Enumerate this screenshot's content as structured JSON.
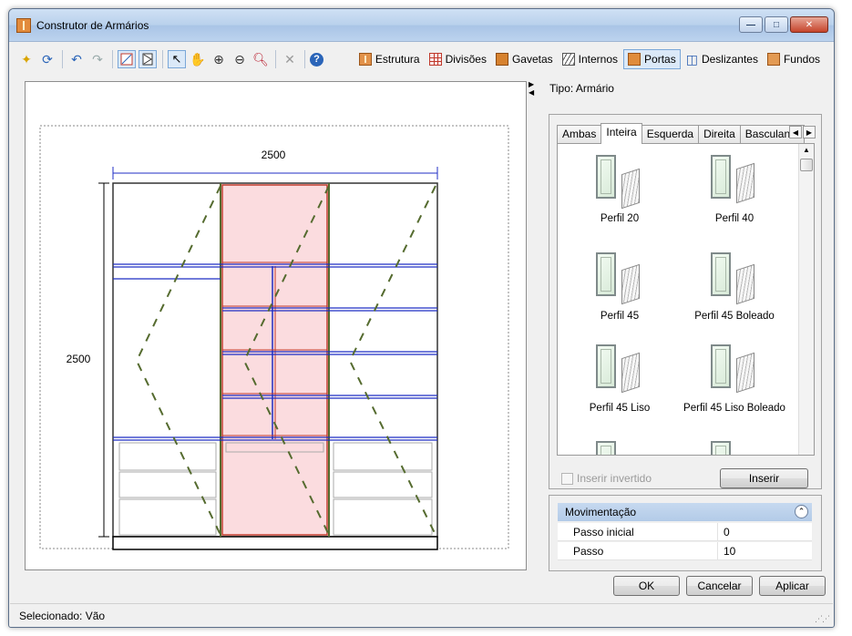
{
  "window": {
    "title": "Construtor de Armários",
    "controls": {
      "minimize": "—",
      "maximize": "□",
      "close": "✕"
    }
  },
  "toolbar": {
    "left_icons": [
      "new-icon",
      "refresh-icon",
      "undo-icon",
      "redo-icon",
      "door-mode-icon",
      "panel-mode-icon",
      "select-icon",
      "hand-add-icon",
      "zoom-extent-icon",
      "zoom-out-icon",
      "zoom-in-icon",
      "delete-icon",
      "help-icon"
    ],
    "buttons": {
      "estrutura": "Estrutura",
      "divisoes": "Divisões",
      "gavetas": "Gavetas",
      "internos": "Internos",
      "portas": "Portas",
      "deslizantes": "Deslizantes",
      "fundos": "Fundos"
    }
  },
  "drawing": {
    "width_label": "2500",
    "height_label": "2500",
    "colors": {
      "selected_fill": "#fbdcdf",
      "selected_stroke": "#c0392b",
      "shelf": "#1f2ec4",
      "door_diag": "#556b2f",
      "frame": "#000000"
    }
  },
  "right": {
    "tipo": "Tipo: Armário",
    "tabs": [
      "Ambas",
      "Inteira",
      "Esquerda",
      "Direita",
      "Basculante"
    ],
    "active_tab": "Inteira",
    "gallery": [
      {
        "name": "Perfil 20"
      },
      {
        "name": "Perfil 40"
      },
      {
        "name": "Perfil 45"
      },
      {
        "name": "Perfil 45 Boleado"
      },
      {
        "name": "Perfil 45 Liso"
      },
      {
        "name": "Perfil 45 Liso Boleado"
      }
    ],
    "inverted_label": "Inserir invertido",
    "insert_button": "Inserir"
  },
  "movement": {
    "title": "Movimentação",
    "rows": [
      {
        "key": "Passo inicial",
        "value": "0"
      },
      {
        "key": "Passo",
        "value": "10"
      }
    ]
  },
  "footer": {
    "ok": "OK",
    "cancel": "Cancelar",
    "apply": "Aplicar"
  },
  "status": {
    "text": "Selecionado:  Vão"
  }
}
